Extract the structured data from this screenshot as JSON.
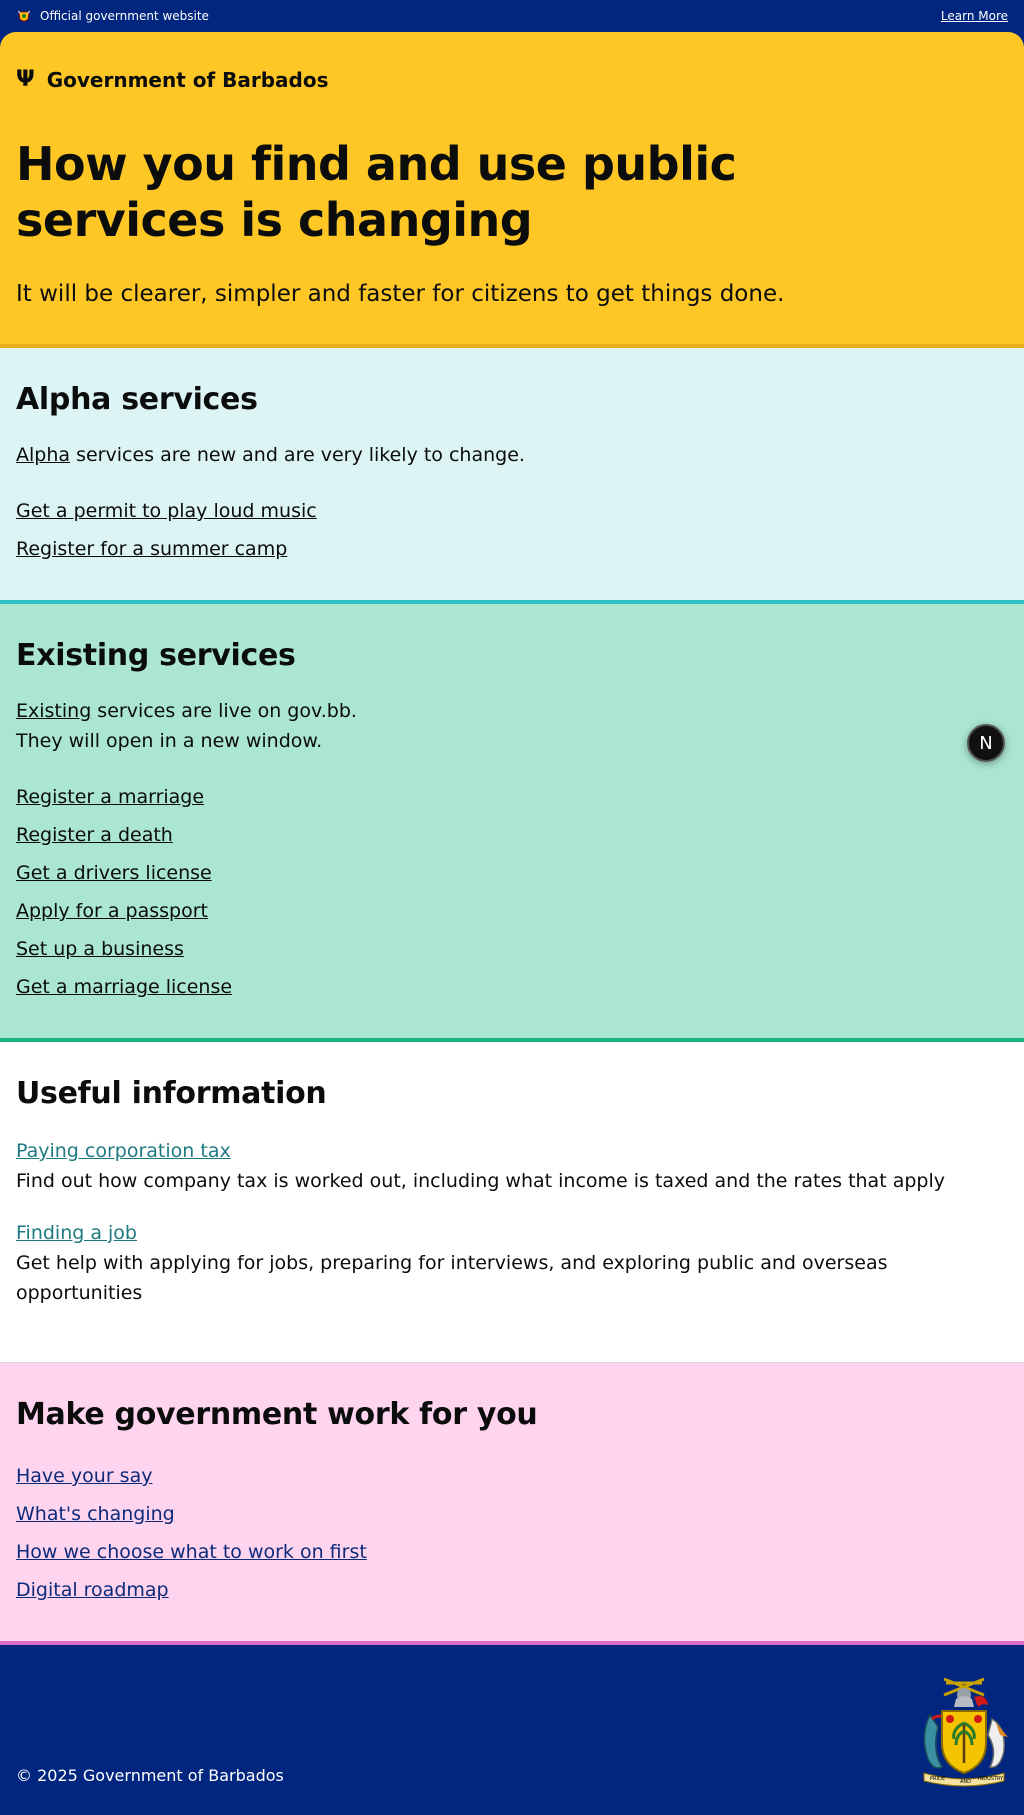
{
  "topbar": {
    "official_text": "Official government website",
    "learn_more": "Learn More",
    "icon": "barbados-crest-icon"
  },
  "hero": {
    "brand": "Government of Barbados",
    "brand_icon": "trident-icon",
    "title": "How you find and use public services is changing",
    "lead": "It will be clearer, simpler and faster for citizens to get things done."
  },
  "alpha": {
    "heading": "Alpha services",
    "intro_link": "Alpha",
    "intro_rest": " services are new and are very likely to change.",
    "links": [
      "Get a permit to play loud music",
      "Register for a summer camp"
    ]
  },
  "existing": {
    "heading": "Existing services",
    "intro_link": "Existing",
    "intro_rest": " services are live on gov.bb.",
    "intro_line2": "They will open in a new window.",
    "links": [
      "Register a marriage",
      "Register a death",
      "Get a drivers license",
      "Apply for a passport",
      "Set up a business",
      "Get a marriage license"
    ],
    "fab_label": "N"
  },
  "useful": {
    "heading": "Useful information",
    "items": [
      {
        "link": "Paying corporation tax",
        "desc": "Find out how company tax is worked out, including what income is taxed and the rates that apply"
      },
      {
        "link": "Finding a job",
        "desc": "Get help with applying for jobs, preparing for interviews, and exploring public and overseas opportunities"
      }
    ]
  },
  "make": {
    "heading": "Make government work for you",
    "links": [
      "Have your say",
      "What's changing",
      "How we choose what to work on first",
      "Digital roadmap"
    ]
  },
  "footer": {
    "copyright": "© 2025 Government of Barbados",
    "coat_icon": "coat-of-arms-icon",
    "motto_words": [
      "PRIDE",
      "AND",
      "INDUSTRY"
    ]
  },
  "colors": {
    "navy": "#00267f",
    "yellow": "#ffc726",
    "alpha_bg": "#ddf4f4",
    "existing_bg": "#aae6d0",
    "make_bg": "#ffd4ef",
    "teal_link": "#1f7a80"
  }
}
